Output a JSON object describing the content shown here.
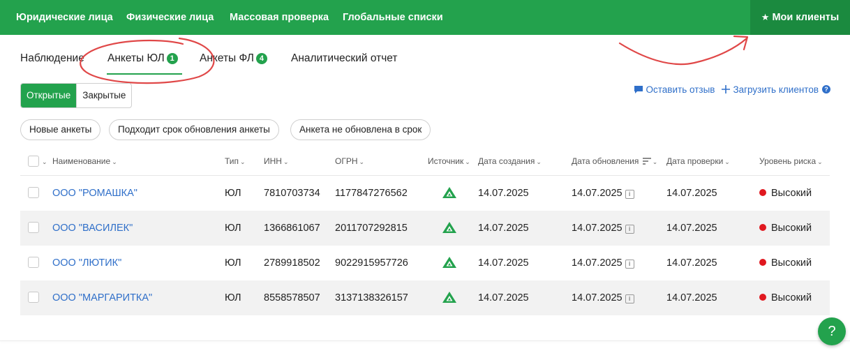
{
  "topnav": {
    "items": [
      "Юридические лица",
      "Физические лица",
      "Массовая проверка",
      "Глобальные списки"
    ],
    "clients_label": "Мои клиенты"
  },
  "tabs": [
    {
      "label": "Наблюдение"
    },
    {
      "label": "Анкеты ЮЛ",
      "badge": "1"
    },
    {
      "label": "Анкеты ФЛ",
      "badge": "4"
    },
    {
      "label": "Аналитический отчет"
    }
  ],
  "status_toggle": {
    "open": "Открытые",
    "closed": "Закрытые"
  },
  "actions": {
    "feedback": "Оставить отзыв",
    "upload": "Загрузить клиентов",
    "help": "?"
  },
  "filters": [
    "Новые анкеты",
    "Подходит срок обновления анкеты",
    "Анкета не обновлена в срок"
  ],
  "columns": {
    "name": "Наименование",
    "type": "Тип",
    "inn": "ИНН",
    "ogrn": "ОГРН",
    "source": "Источник",
    "created": "Дата создания",
    "updated": "Дата обновления",
    "checked": "Дата проверки",
    "risk": "Уровень риска"
  },
  "rows": [
    {
      "name": "ООО \"РОМАШКА\"",
      "type": "ЮЛ",
      "inn": "7810703734",
      "ogrn": "1177847276562",
      "created": "14.07.2025",
      "updated": "14.07.2025",
      "checked": "14.07.2025",
      "risk": "Высокий"
    },
    {
      "name": "ООО \"ВАСИЛЕК\"",
      "type": "ЮЛ",
      "inn": "1366861067",
      "ogrn": "2011707292815",
      "created": "14.07.2025",
      "updated": "14.07.2025",
      "checked": "14.07.2025",
      "risk": "Высокий"
    },
    {
      "name": "ООО \"ЛЮТИК\"",
      "type": "ЮЛ",
      "inn": "2789918502",
      "ogrn": "9022915957726",
      "created": "14.07.2025",
      "updated": "14.07.2025",
      "checked": "14.07.2025",
      "risk": "Высокий"
    },
    {
      "name": "ООО \"МАРГАРИТКА\"",
      "type": "ЮЛ",
      "inn": "8558578507",
      "ogrn": "3137138326157",
      "created": "14.07.2025",
      "updated": "14.07.2025",
      "checked": "14.07.2025",
      "risk": "Высокий"
    }
  ],
  "help_button": "?",
  "colors": {
    "brand": "#23a24d",
    "brand_dark": "#1b8a3f",
    "link": "#2f6fc9",
    "risk_high": "#e0181f",
    "annotation": "#e04848"
  },
  "icons": {
    "star": "star-icon",
    "feedback": "chat-bubble-icon",
    "upload": "plus-icon",
    "source": "source-logo-icon",
    "info": "info-icon",
    "sort": "sort-icon"
  }
}
